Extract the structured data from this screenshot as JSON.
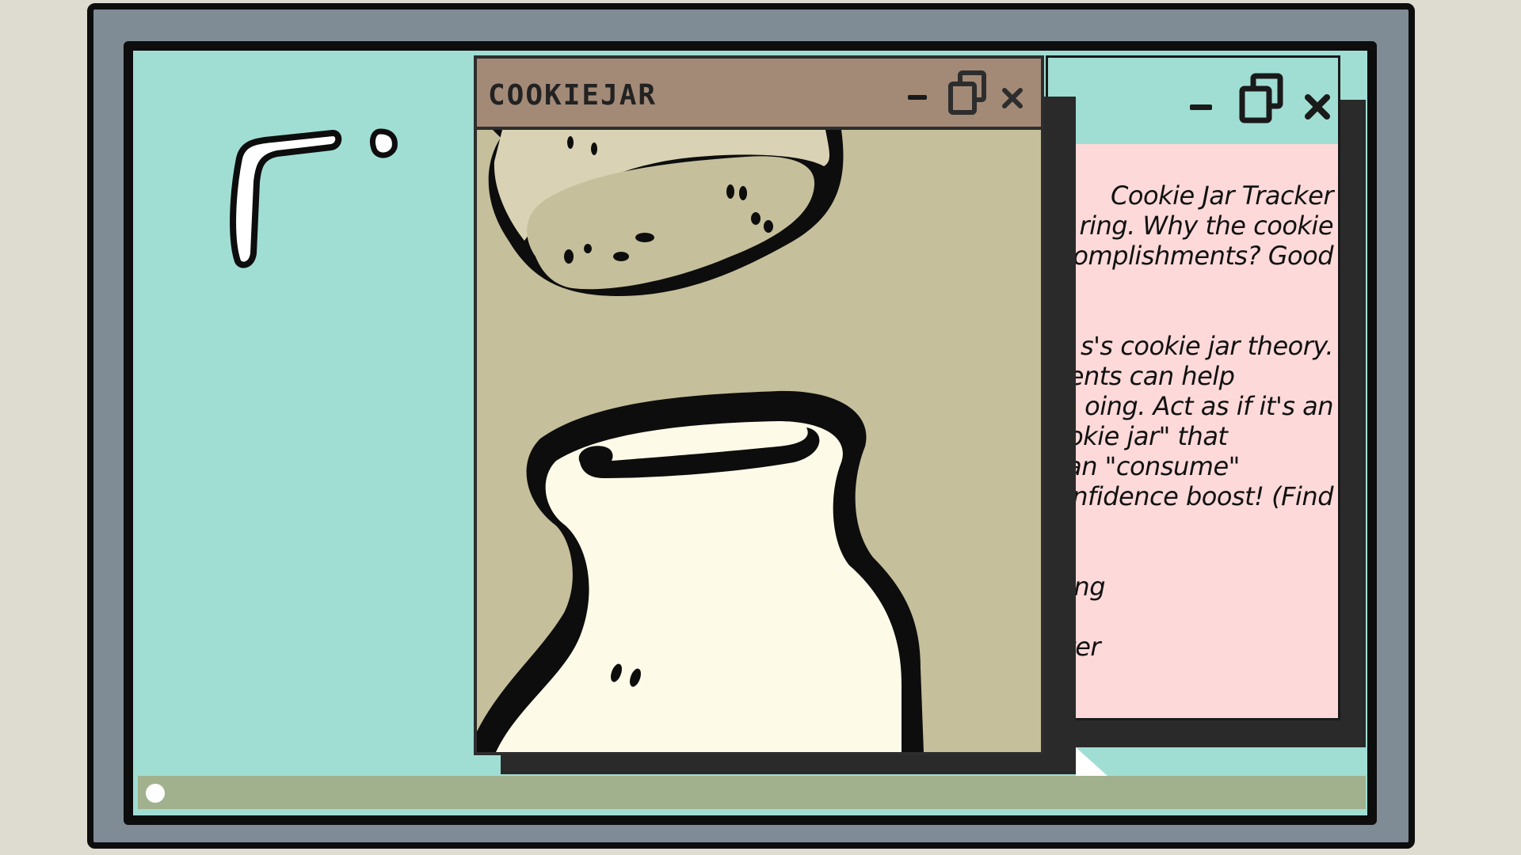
{
  "windows": {
    "cookiejar": {
      "title": "COOKIEJAR",
      "controls": {
        "minimize": "–",
        "restore": "❐",
        "close": "×"
      }
    },
    "notes": {
      "controls": {
        "minimize": "–",
        "restore": "❐",
        "close": "×"
      },
      "lines": [
        "Cookie Jar Tracker",
        "ring. Why the cookie",
        "omplishments? Good",
        "s's cookie jar theory.",
        "nents can help",
        "oing. Act as if it's an",
        "ookie jar\" that",
        "can \"consume\"",
        "nfidence boost! (Find",
        "king",
        "ster"
      ]
    }
  },
  "colors": {
    "screen": "#a0ded4",
    "cookiejar_titlebar": "#a38a77",
    "cookiejar_body": "#c5bf9b",
    "notes_body": "#fdd9d9",
    "taskbar": "#a2b18d",
    "bezel": "#7f8c96"
  },
  "icons": [
    "minimize-icon",
    "restore-icon",
    "close-icon",
    "start-button-icon"
  ]
}
